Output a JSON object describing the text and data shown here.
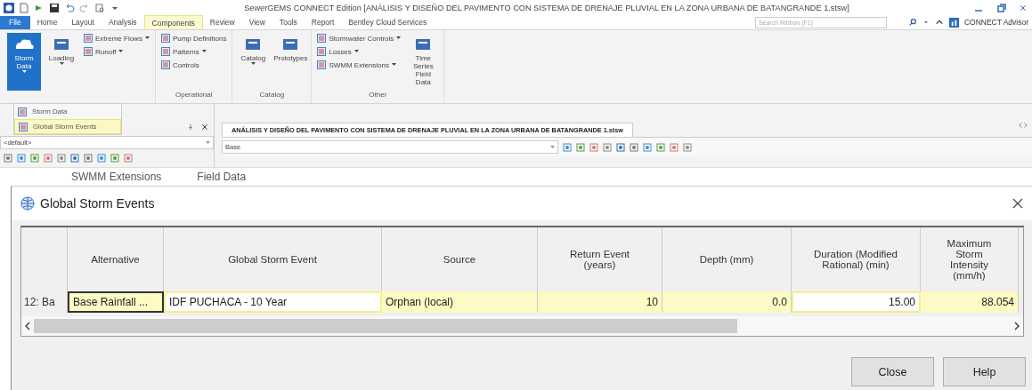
{
  "app": {
    "title": "SewerGEMS CONNECT Edition [ANÁLISIS Y DISEÑO DEL PAVIMENTO CON SISTEMA DE DRENAJE PLUVIAL EN LA ZONA URBANA DE BATANGRANDE 1.stsw]",
    "menu_tabs": [
      {
        "label": "File",
        "kind": "file",
        "selected": false
      },
      {
        "label": "Home",
        "kind": "tab",
        "selected": false
      },
      {
        "label": "Layout",
        "kind": "tab",
        "selected": false
      },
      {
        "label": "Analysis",
        "kind": "tab",
        "selected": false
      },
      {
        "label": "Components",
        "kind": "tab",
        "selected": true
      },
      {
        "label": "Review",
        "kind": "tab",
        "selected": false
      },
      {
        "label": "View",
        "kind": "tab",
        "selected": false
      },
      {
        "label": "Tools",
        "kind": "tab",
        "selected": false
      },
      {
        "label": "Report",
        "kind": "tab",
        "selected": false
      },
      {
        "label": "Bentley Cloud Services",
        "kind": "tab",
        "selected": false
      }
    ],
    "search": {
      "placeholder": "Search Ribbon (F1)"
    },
    "advisor": "CONNECT Advisor",
    "ribbon_groups": [
      {
        "items": [
          {
            "label": "Storm Data",
            "kind": "large",
            "has_menu": true,
            "selected": true
          },
          {
            "label": "Loading",
            "kind": "large",
            "has_menu": true,
            "selected": false
          },
          {
            "label": "Extreme Flows",
            "kind": "small",
            "has_menu": true,
            "selected": false
          },
          {
            "label": "Runoff",
            "kind": "small",
            "has_menu": true,
            "selected": false
          }
        ]
      },
      {
        "label": "Operational",
        "items": [
          {
            "label": "Pump Definitions",
            "kind": "small",
            "has_menu": false,
            "selected": false
          },
          {
            "label": "Patterns",
            "kind": "small",
            "has_menu": true,
            "selected": false
          },
          {
            "label": "Controls",
            "kind": "small",
            "has_menu": false,
            "selected": false
          }
        ]
      },
      {
        "label": "Catalog",
        "items": [
          {
            "label": "Catalog",
            "kind": "large",
            "has_menu": true,
            "selected": false
          },
          {
            "label": "Prototypes",
            "kind": "large",
            "has_menu": false,
            "selected": false
          }
        ]
      },
      {
        "label": "Other",
        "items": [
          {
            "label": "Stormwater Controls",
            "kind": "small",
            "has_menu": true,
            "selected": false
          },
          {
            "label": "Losses",
            "kind": "small",
            "has_menu": true,
            "selected": false
          },
          {
            "label": "SWMM Extensions",
            "kind": "small",
            "has_menu": true,
            "selected": false
          },
          {
            "label": "Time Series Field Data",
            "kind": "large",
            "has_menu": false,
            "selected": false
          }
        ]
      }
    ],
    "dropdown_menu": [
      {
        "label": "Storm Data",
        "selected": false
      },
      {
        "label": "Global Storm Events",
        "selected": true
      }
    ],
    "side_panel": {
      "scenario": "<default>"
    },
    "document": {
      "tab": "ANÁLISIS Y DISEÑO DEL PAVIMENTO CON SISTEMA DE DRENAJE PLUVIAL EN LA ZONA URBANA DE BATANGRANDE 1.stsw",
      "scenario": "Base"
    },
    "background_tabs": [
      "SWMM Extensions",
      "Field Data"
    ]
  },
  "dialog": {
    "title": "Global Storm Events",
    "columns": [
      "Alternative",
      "Global Storm Event",
      "Source",
      "Return Event (years)",
      "Depth (mm)",
      "Duration (Modified Rational) (min)",
      "Maximum Storm Intensity (mm/h)"
    ],
    "rows": [
      {
        "row_header": "12: Ba",
        "cells": [
          {
            "text": "Base Rainfall ...",
            "kind": "readonly",
            "focused": true
          },
          {
            "text": "IDF PUCHACA - 10 Year",
            "kind": "editable",
            "focused": false
          },
          {
            "text": "Orphan (local)",
            "kind": "readonly",
            "focused": false
          },
          {
            "text": "10",
            "kind": "readonly",
            "focused": false
          },
          {
            "text": "0.0",
            "kind": "readonly",
            "focused": false
          },
          {
            "text": "15.00",
            "kind": "editable",
            "focused": false
          },
          {
            "text": "88.054",
            "kind": "readonly",
            "focused": false
          }
        ]
      }
    ],
    "buttons": [
      "Close",
      "Help"
    ]
  }
}
